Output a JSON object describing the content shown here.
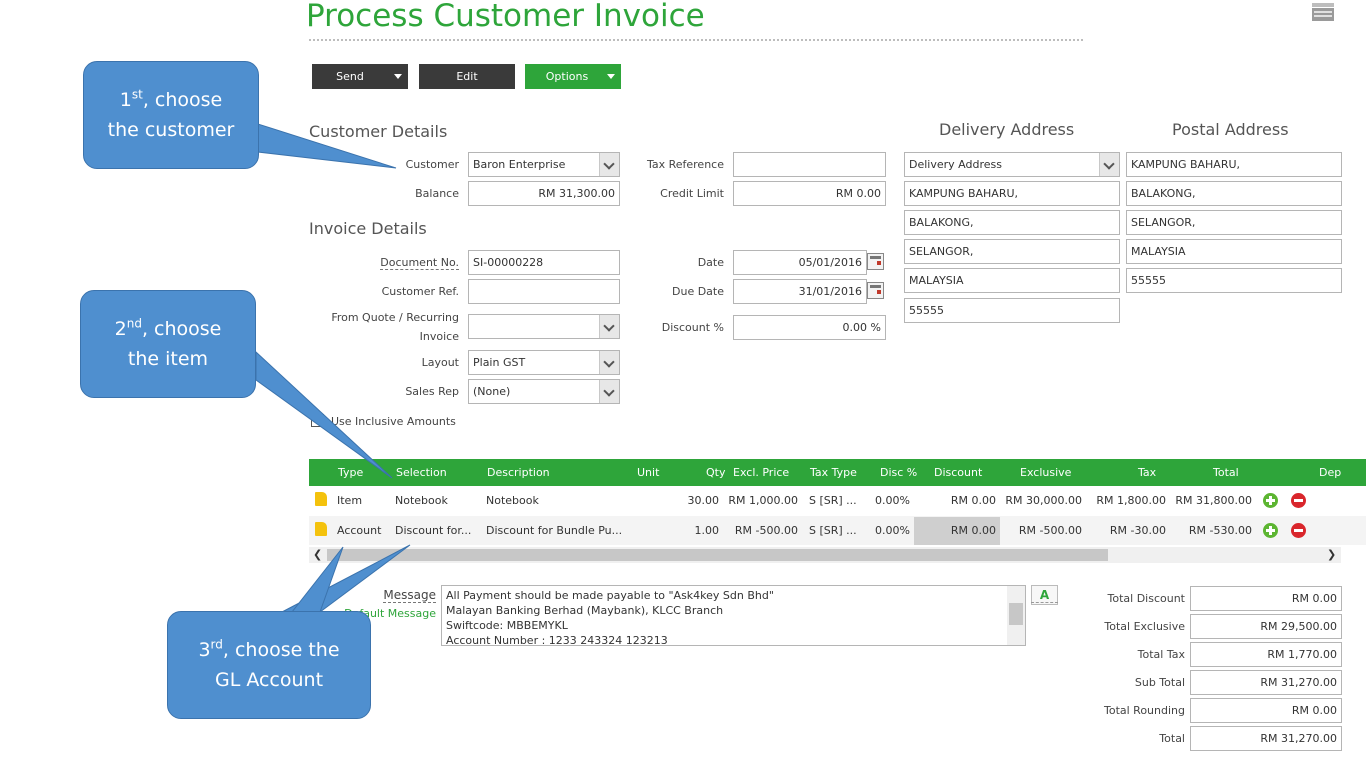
{
  "title": "Process Customer Invoice",
  "toolbar": {
    "send": "Send",
    "edit": "Edit",
    "options": "Options"
  },
  "customer_details": {
    "heading": "Customer Details",
    "customer_label": "Customer",
    "customer_value": "Baron Enterprise",
    "balance_label": "Balance",
    "balance_value": "RM 31,300.00",
    "tax_ref_label": "Tax Reference",
    "tax_ref_value": "",
    "credit_limit_label": "Credit Limit",
    "credit_limit_value": "RM 0.00"
  },
  "invoice_details": {
    "heading": "Invoice Details",
    "doc_no_label": "Document No.",
    "doc_no_value": "SI-00000228",
    "cust_ref_label": "Customer Ref.",
    "cust_ref_value": "",
    "from_quote_label_1": "From Quote / Recurring",
    "from_quote_label_2": "Invoice",
    "from_quote_value": "",
    "layout_label": "Layout",
    "layout_value": "Plain GST",
    "sales_rep_label": "Sales Rep",
    "sales_rep_value": "(None)",
    "date_label": "Date",
    "date_value": "05/01/2016",
    "due_date_label": "Due Date",
    "due_date_value": "31/01/2016",
    "discount_label": "Discount %",
    "discount_value": "0.00 %",
    "inclusive_label": "Use Inclusive Amounts"
  },
  "delivery_address": {
    "heading": "Delivery Address",
    "selector": "Delivery Address",
    "lines": [
      "KAMPUNG BAHARU,",
      "BALAKONG,",
      "SELANGOR,",
      "MALAYSIA",
      "55555"
    ]
  },
  "postal_address": {
    "heading": "Postal Address",
    "lines": [
      "KAMPUNG BAHARU,",
      "BALAKONG,",
      "SELANGOR,",
      "MALAYSIA",
      "55555"
    ]
  },
  "grid": {
    "headers": [
      "Type",
      "Selection",
      "Description",
      "Unit",
      "Qty",
      "Excl. Price",
      "Tax Type",
      "Disc %",
      "Discount",
      "Exclusive",
      "Tax",
      "Total",
      "Dep"
    ],
    "rows": [
      {
        "type": "Item",
        "selection": "Notebook",
        "description": "Notebook",
        "unit": "",
        "qty": "30.00",
        "excl_price": "RM 1,000.00",
        "tax_type": "S [SR] ...",
        "disc_pct": "0.00%",
        "discount": "RM 0.00",
        "exclusive": "RM 30,000.00",
        "tax": "RM 1,800.00",
        "total": "RM 31,800.00"
      },
      {
        "type": "Account",
        "selection": "Discount for...",
        "description": "Discount for Bundle Pu...",
        "unit": "",
        "qty": "1.00",
        "excl_price": "RM -500.00",
        "tax_type": "S [SR] ...",
        "disc_pct": "0.00%",
        "discount": "RM 0.00",
        "exclusive": "RM -500.00",
        "tax": "RM -30.00",
        "total": "RM -530.00"
      }
    ]
  },
  "message": {
    "label": "Message",
    "default_link": "Default Message",
    "lines": [
      "All Payment should be made payable to \"Ask4key Sdn Bhd\"",
      "Malayan Banking Berhad (Maybank), KLCC Branch",
      "Swiftcode: MBBEMYKL",
      "Account Number : 1233 243324 123213"
    ]
  },
  "totals": [
    {
      "label": "Total Discount",
      "value": "RM 0.00"
    },
    {
      "label": "Total Exclusive",
      "value": "RM 29,500.00"
    },
    {
      "label": "Total Tax",
      "value": "RM 1,770.00"
    },
    {
      "label": "Sub Total",
      "value": "RM 31,270.00"
    },
    {
      "label": "Total Rounding",
      "value": "RM 0.00"
    },
    {
      "label": "Total",
      "value": "RM 31,270.00"
    }
  ],
  "callouts": {
    "one": {
      "num": "1",
      "sup": "st",
      "line1_rest": ", choose",
      "line2": "the customer"
    },
    "two": {
      "num": "2",
      "sup": "nd",
      "line1_rest": ", choose",
      "line2": "the item"
    },
    "three": {
      "num": "3",
      "sup": "rd",
      "line1_rest": ", choose the",
      "line2": "GL Account"
    }
  },
  "colors": {
    "accent_green": "#2ea53a",
    "dark_button": "#3a3a3a",
    "callout_blue": "#4f8fcf"
  }
}
